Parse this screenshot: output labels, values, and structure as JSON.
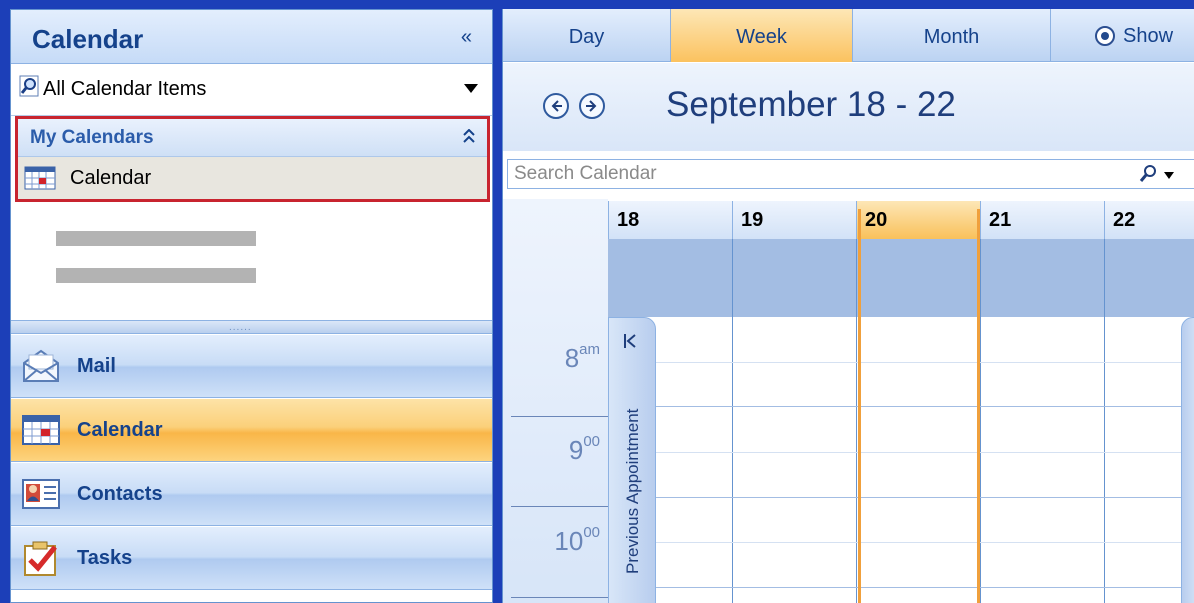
{
  "nav": {
    "title": "Calendar",
    "collapse_glyph": "«",
    "view_selector": "All Calendar Items",
    "my_calendars": {
      "title": "My Calendars",
      "collapse_glyph": "⌃",
      "items": [
        {
          "label": "Calendar"
        }
      ]
    },
    "buttons": [
      {
        "label": "Mail",
        "icon": "mail-icon",
        "active": false
      },
      {
        "label": "Calendar",
        "icon": "calendar-icon",
        "active": true
      },
      {
        "label": "Contacts",
        "icon": "contacts-icon",
        "active": false
      },
      {
        "label": "Tasks",
        "icon": "tasks-icon",
        "active": false
      }
    ]
  },
  "tabs": [
    {
      "label": "Day",
      "active": false
    },
    {
      "label": "Week",
      "active": true
    },
    {
      "label": "Month",
      "active": false
    }
  ],
  "show_option": "Show",
  "date_range": "September 18 - 22",
  "search": {
    "placeholder": "Search Calendar"
  },
  "days": [
    "18",
    "19",
    "20",
    "21",
    "22"
  ],
  "today_day": "20",
  "times": [
    {
      "hour": "8",
      "suffix": "am"
    },
    {
      "hour": "9",
      "suffix": "00"
    },
    {
      "hour": "10",
      "suffix": "00"
    }
  ],
  "previous_appointment": "Previous Appointment",
  "colors": {
    "accent": "#f9b648",
    "selection_border": "#c8242f",
    "brand": "#15428b"
  }
}
